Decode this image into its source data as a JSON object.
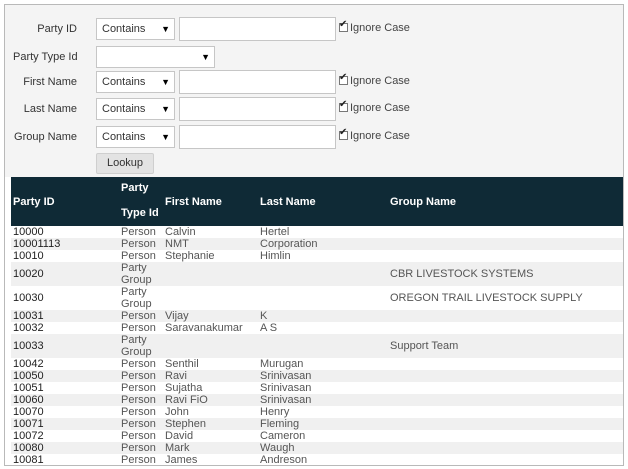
{
  "form": {
    "party_id": {
      "label": "Party ID",
      "operator": "Contains",
      "value": "",
      "ignore_case": "Ignore Case"
    },
    "party_type_id": {
      "label": "Party Type Id",
      "value": ""
    },
    "first_name": {
      "label": "First Name",
      "operator": "Contains",
      "value": "",
      "ignore_case": "Ignore Case"
    },
    "last_name": {
      "label": "Last Name",
      "operator": "Contains",
      "value": "",
      "ignore_case": "Ignore Case"
    },
    "group_name": {
      "label": "Group Name",
      "operator": "Contains",
      "value": "",
      "ignore_case": "Ignore Case"
    },
    "lookup_label": "Lookup"
  },
  "table": {
    "headers": {
      "party_id": "Party ID",
      "party_type_line1": "Party",
      "party_type_line2": "Type Id",
      "first_name": "First Name",
      "last_name": "Last Name",
      "group_name": "Group Name"
    },
    "rows": [
      {
        "id": "10000",
        "type": "Person",
        "first": "Calvin",
        "last": "Hertel",
        "group": ""
      },
      {
        "id": "10001113",
        "type": "Person",
        "first": "NMT",
        "last": "Corporation",
        "group": ""
      },
      {
        "id": "10010",
        "type": "Person",
        "first": "Stephanie",
        "last": "Himlin",
        "group": ""
      },
      {
        "id": "10020",
        "type": "Party Group",
        "first": "",
        "last": "",
        "group": "CBR LIVESTOCK SYSTEMS"
      },
      {
        "id": "10030",
        "type": "Party Group",
        "first": "",
        "last": "",
        "group": "OREGON TRAIL LIVESTOCK SUPPLY"
      },
      {
        "id": "10031",
        "type": "Person",
        "first": "Vijay",
        "last": "K",
        "group": ""
      },
      {
        "id": "10032",
        "type": "Person",
        "first": "Saravanakumar",
        "last": "A S",
        "group": ""
      },
      {
        "id": "10033",
        "type": "Party Group",
        "first": "",
        "last": "",
        "group": "Support Team"
      },
      {
        "id": "10042",
        "type": "Person",
        "first": "Senthil",
        "last": "Murugan",
        "group": ""
      },
      {
        "id": "10050",
        "type": "Person",
        "first": "Ravi",
        "last": "Srinivasan",
        "group": ""
      },
      {
        "id": "10051",
        "type": "Person",
        "first": "Sujatha",
        "last": "Srinivasan",
        "group": ""
      },
      {
        "id": "10060",
        "type": "Person",
        "first": "Ravi FiO",
        "last": "Srinivasan",
        "group": ""
      },
      {
        "id": "10070",
        "type": "Person",
        "first": "John",
        "last": "Henry",
        "group": ""
      },
      {
        "id": "10071",
        "type": "Person",
        "first": "Stephen",
        "last": "Fleming",
        "group": ""
      },
      {
        "id": "10072",
        "type": "Person",
        "first": "David",
        "last": "Cameron",
        "group": ""
      },
      {
        "id": "10080",
        "type": "Person",
        "first": "Mark",
        "last": "Waugh",
        "group": ""
      },
      {
        "id": "10081",
        "type": "Person",
        "first": "James",
        "last": "Andreson",
        "group": ""
      }
    ]
  }
}
